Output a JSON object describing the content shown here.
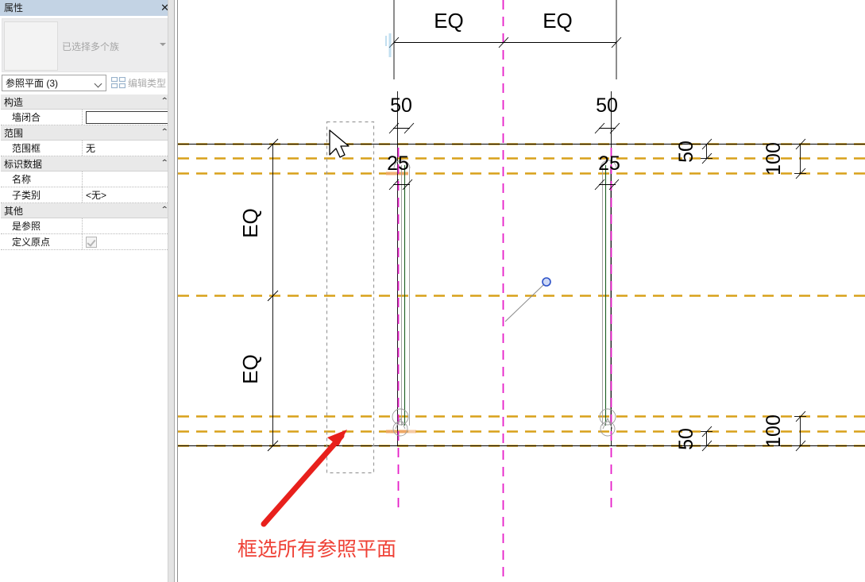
{
  "properties_panel": {
    "title": "属性",
    "close_icon": "close-icon",
    "type_preview": {
      "name": "已选择多个族",
      "dropdown_icon": "chevron-down-icon"
    },
    "type_selector": {
      "value": "参照平面 (3)",
      "chevron_icon": "chevron-down-icon",
      "edit_type_label": "编辑类型",
      "edit_type_icon": "edit-type-icon"
    },
    "groups": [
      {
        "label": "构造",
        "collapse_icon": "chevron-up-icon",
        "rows": [
          {
            "name": "墙闭合",
            "value": "",
            "control": "checkbox-empty"
          }
        ]
      },
      {
        "label": "范围",
        "collapse_icon": "chevron-up-icon",
        "rows": [
          {
            "name": "范围框",
            "value": "无",
            "control": "text"
          }
        ]
      },
      {
        "label": "标识数据",
        "collapse_icon": "chevron-up-icon",
        "rows": [
          {
            "name": "名称",
            "value": "",
            "control": "text"
          },
          {
            "name": "子类别",
            "value": "<无>",
            "control": "text"
          }
        ]
      },
      {
        "label": "其他",
        "collapse_icon": "chevron-up-icon",
        "rows": [
          {
            "name": "是参照",
            "value": "",
            "control": "text"
          },
          {
            "name": "定义原点",
            "value": "",
            "control": "checkbox-checked-disabled"
          }
        ]
      }
    ]
  },
  "canvas": {
    "annotation": {
      "text": "框选所有参照平面",
      "color": "#ef4136",
      "arrow_icon": "arrow-pointer-icon"
    },
    "cursor_icon": "mouse-pointer-icon",
    "selection_box_icon": "selection-rectangle",
    "drag_handle_icon": "circle-handle-icon",
    "colors": {
      "reference_plane": "#D8A11A",
      "ref_plane_highlight": "#F0A868",
      "center_line": "#E61EC8",
      "geometry": "#000000",
      "wall_layer": "#1A5E20",
      "wall_outline": "#9b9b9b",
      "selection_box": "#9b9b9b",
      "handle": "#2d52c8"
    },
    "dimensions": {
      "top_horizontal": [
        {
          "label": "EQ",
          "orientation": "horizontal"
        },
        {
          "label": "EQ",
          "orientation": "horizontal"
        }
      ],
      "left_vertical": [
        {
          "label": "EQ",
          "orientation": "vertical"
        },
        {
          "label": "EQ",
          "orientation": "vertical"
        }
      ],
      "upper_inner": [
        {
          "label": "50",
          "orientation": "horizontal"
        },
        {
          "label": "25",
          "orientation": "horizontal"
        },
        {
          "label": "50",
          "orientation": "horizontal"
        },
        {
          "label": "25",
          "orientation": "horizontal"
        }
      ],
      "right_upper": [
        {
          "label": "50",
          "orientation": "vertical"
        },
        {
          "label": "100",
          "orientation": "vertical"
        }
      ],
      "right_lower": [
        {
          "label": "50",
          "orientation": "vertical"
        },
        {
          "label": "100",
          "orientation": "vertical"
        }
      ]
    }
  }
}
